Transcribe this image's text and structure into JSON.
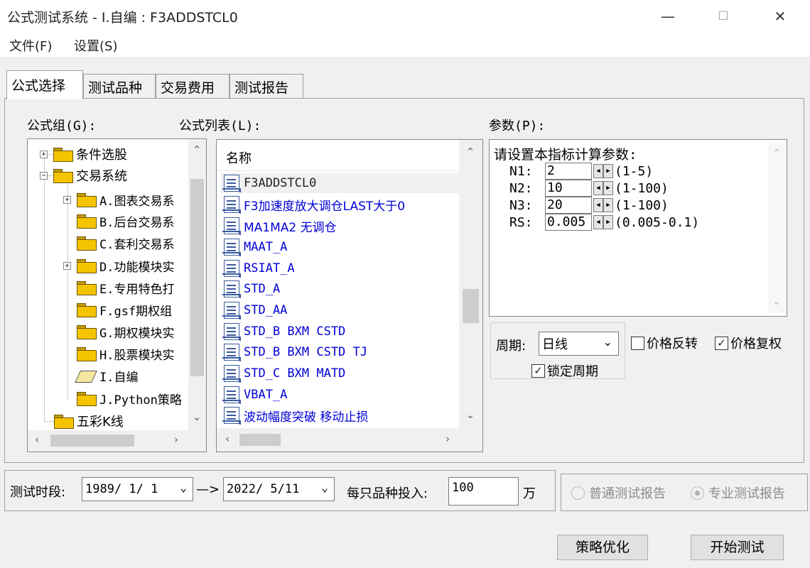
{
  "window": {
    "title": "公式测试系统 - I.自编 : F3ADDSTCL0",
    "minimize": "—",
    "maximize": "☐",
    "close": "✕"
  },
  "menu": [
    "文件(F)",
    "设置(S)"
  ],
  "tabs": [
    "公式选择",
    "测试品种",
    "交易费用",
    "测试报告"
  ],
  "formula_group": {
    "label": "公式组(G):",
    "items": [
      {
        "label": "条件选股",
        "level": 0,
        "expander": "+"
      },
      {
        "label": "交易系统",
        "level": 0,
        "expander": "−"
      },
      {
        "label": "A.图表交易系",
        "level": 1,
        "expander": "+"
      },
      {
        "label": "B.后台交易系",
        "level": 1,
        "expander": ""
      },
      {
        "label": "C.套利交易系",
        "level": 1,
        "expander": ""
      },
      {
        "label": "D.功能模块实",
        "level": 1,
        "expander": "+"
      },
      {
        "label": "E.专用特色打",
        "level": 1,
        "expander": ""
      },
      {
        "label": "F.gsf期权组",
        "level": 1,
        "expander": ""
      },
      {
        "label": "G.期权模块实",
        "level": 1,
        "expander": ""
      },
      {
        "label": "H.股票模块实",
        "level": 1,
        "expander": ""
      },
      {
        "label": "I.自编",
        "level": 1,
        "expander": "",
        "selected": true
      },
      {
        "label": "J.Python策略",
        "level": 1,
        "expander": ""
      },
      {
        "label": "五彩K线",
        "level": 0,
        "expander": ""
      }
    ]
  },
  "formula_list": {
    "label": "公式列表(L):",
    "header": "名称",
    "items": [
      {
        "label": "F3ADDSTCL0",
        "selected": true
      },
      {
        "label": "F3加速度放大调仓LAST大于0"
      },
      {
        "label": "MA1MA2 无调仓"
      },
      {
        "label": "MAAT_A"
      },
      {
        "label": "RSIAT_A"
      },
      {
        "label": "STD_A"
      },
      {
        "label": "STD_AA"
      },
      {
        "label": "STD_B BXM CSTD"
      },
      {
        "label": "STD_B BXM CSTD TJ"
      },
      {
        "label": "STD_C BXM MATD"
      },
      {
        "label": "VBAT_A"
      },
      {
        "label": "波动幅度突破 移动止损"
      }
    ]
  },
  "params": {
    "label": "参数(P):",
    "heading": "请设置本指标计算参数:",
    "rows": [
      {
        "name": "N1:",
        "value": "2",
        "range": "(1-5)"
      },
      {
        "name": "N2:",
        "value": "10",
        "range": "(1-100)"
      },
      {
        "name": "N3:",
        "value": "20",
        "range": "(1-100)"
      },
      {
        "name": "RS:",
        "value": "0.005",
        "range": "(0.005-0.1)"
      }
    ]
  },
  "period": {
    "label": "周期:",
    "value": "日线",
    "lock_label": "锁定周期",
    "lock_checked": true
  },
  "options": {
    "price_reverse": "价格反转",
    "price_reverse_checked": false,
    "price_adjust": "价格复权",
    "price_adjust_checked": true
  },
  "test_period": {
    "label": "测试时段:",
    "start": "1989/ 1/ 1",
    "arrow": "—>",
    "end": "2022/ 5/11"
  },
  "investment": {
    "label": "每只品种投入:",
    "value": "100",
    "unit": "万"
  },
  "report_type": {
    "normal": "普通测试报告",
    "pro": "专业测试报告",
    "selected": "pro"
  },
  "buttons": {
    "optimize": "策略优化",
    "start": "开始测试"
  }
}
